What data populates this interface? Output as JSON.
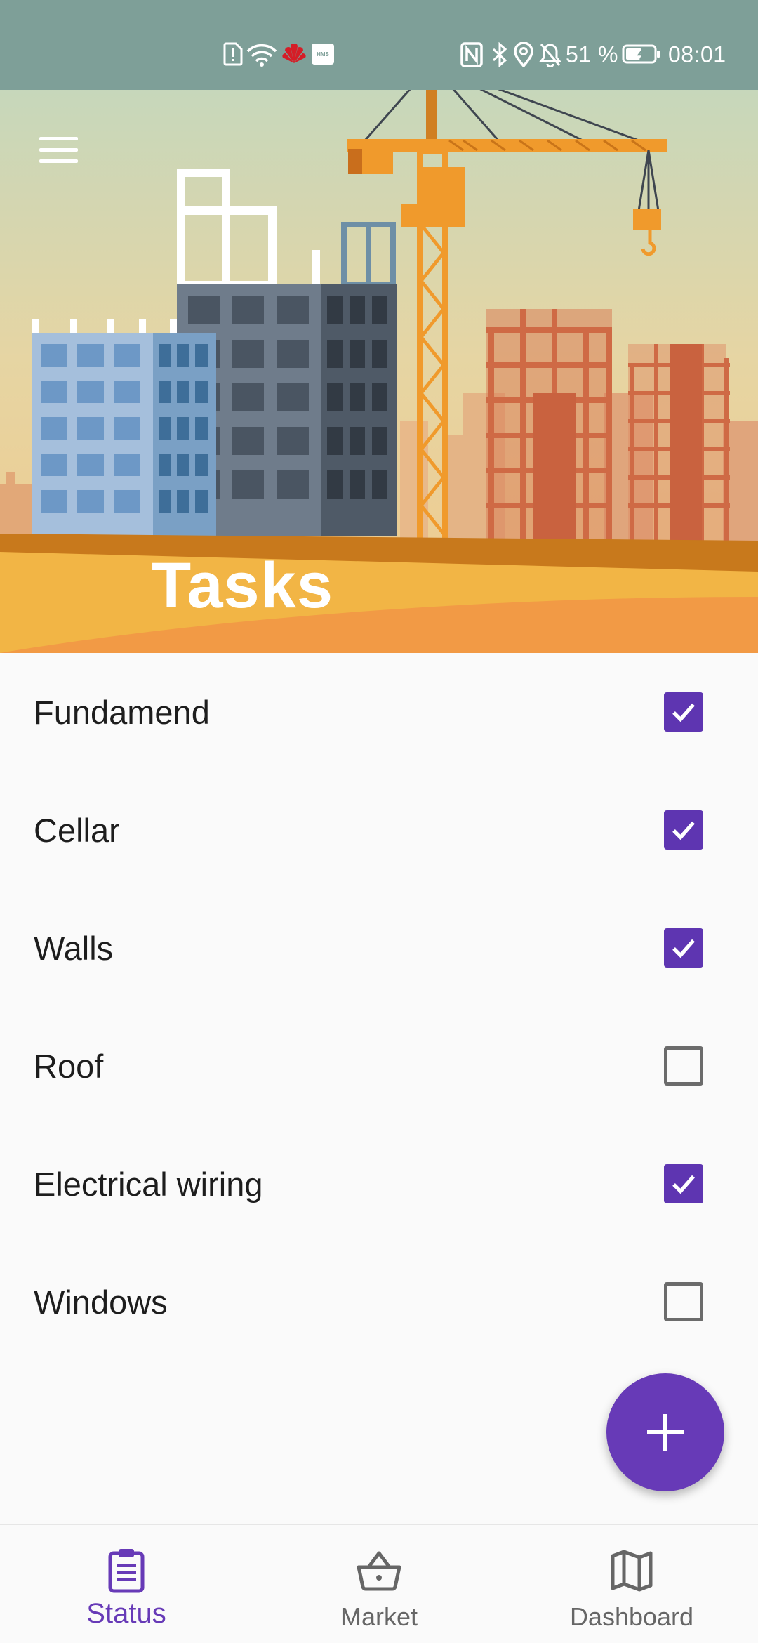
{
  "status_bar": {
    "battery": "51 %",
    "time": "08:01",
    "hms_label": "HMS",
    "left_icons": [
      "sim-alert-icon",
      "wifi-icon",
      "huawei-logo-icon",
      "hms-icon"
    ],
    "right_icons": [
      "nfc-icon",
      "bluetooth-icon",
      "location-icon",
      "bell-off-icon",
      "battery-icon"
    ]
  },
  "header": {
    "title": "Tasks",
    "menu_icon": "menu-icon"
  },
  "tasks": [
    {
      "label": "Fundamend",
      "checked": true
    },
    {
      "label": "Cellar",
      "checked": true
    },
    {
      "label": "Walls",
      "checked": true
    },
    {
      "label": "Roof",
      "checked": false
    },
    {
      "label": "Electrical wiring",
      "checked": true
    },
    {
      "label": "Windows",
      "checked": false
    }
  ],
  "fab": {
    "icon": "plus-icon"
  },
  "bottom_nav": {
    "items": [
      {
        "label": "Status",
        "icon": "clipboard-icon",
        "active": true
      },
      {
        "label": "Market",
        "icon": "basket-icon",
        "active": false
      },
      {
        "label": "Dashboard",
        "icon": "map-icon",
        "active": false
      }
    ]
  },
  "colors": {
    "accent": "#673ab7",
    "status_bar": "#7e9f98",
    "sky_top": "#bcd8c3",
    "sky_bottom": "#f1c98a",
    "ground": "#f2b545",
    "crane": "#f09a2c"
  }
}
